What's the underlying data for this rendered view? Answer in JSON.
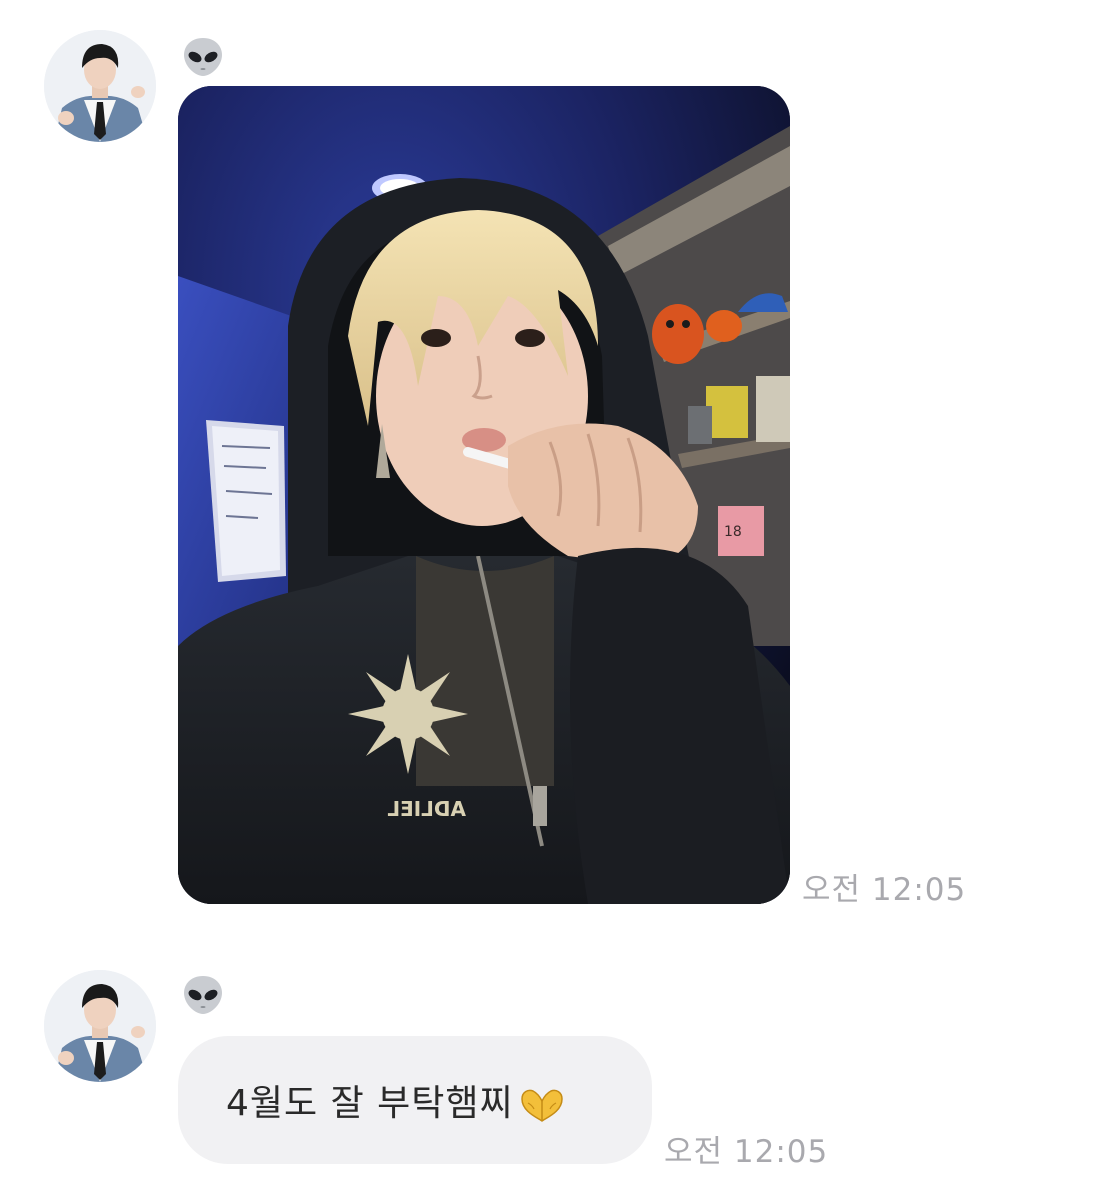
{
  "messages": [
    {
      "type": "image",
      "sender_icon": "alien-emoji-icon",
      "image_alt": "selfie photo",
      "time": "오전 12:05"
    },
    {
      "type": "text",
      "sender_icon": "alien-emoji-icon",
      "text": "4월도 잘 부탁햄찌",
      "text_emoji": "heart-hands-emoji-icon",
      "time": "오전 12:05"
    }
  ],
  "photo_print": {
    "hoodie_text": "ADLIEL",
    "sign_text": "18"
  },
  "colors": {
    "background": "#ffffff",
    "bubble": "#f1f1f3",
    "timestamp": "#a9a9ae",
    "text": "#2a2a2a"
  }
}
